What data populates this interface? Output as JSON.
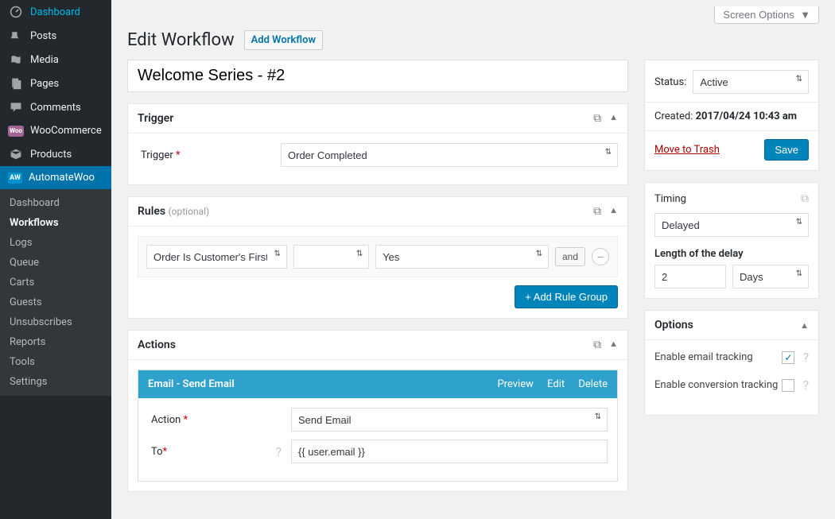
{
  "topbar": {
    "screen_options": "Screen Options"
  },
  "page": {
    "title": "Edit Workflow",
    "add_new": "Add Workflow",
    "workflow_title": "Welcome Series - #2"
  },
  "sidebar": {
    "items": [
      {
        "label": "Dashboard",
        "icon": "dashboard"
      },
      {
        "label": "Posts",
        "icon": "pin"
      },
      {
        "label": "Media",
        "icon": "media"
      },
      {
        "label": "Pages",
        "icon": "page"
      },
      {
        "label": "Comments",
        "icon": "comment"
      },
      {
        "label": "WooCommerce",
        "icon": "woo"
      },
      {
        "label": "Products",
        "icon": "products"
      },
      {
        "label": "AutomateWoo",
        "icon": "aw",
        "active": true
      }
    ],
    "submenu": [
      "Dashboard",
      "Workflows",
      "Logs",
      "Queue",
      "Carts",
      "Guests",
      "Unsubscribes",
      "Reports",
      "Tools",
      "Settings"
    ],
    "submenu_current": "Workflows"
  },
  "trigger": {
    "heading": "Trigger",
    "label": "Trigger",
    "value": "Order Completed"
  },
  "rules": {
    "heading": "Rules",
    "optional": "(optional)",
    "rule_name": "Order Is Customer's First",
    "rule_op": "",
    "rule_value": "Yes",
    "and": "and",
    "add_group": "+ Add Rule Group"
  },
  "actions": {
    "heading": "Actions",
    "block_name": "Email - Send Email",
    "preview": "Preview",
    "edit": "Edit",
    "delete": "Delete",
    "action_label": "Action",
    "action_value": "Send Email",
    "to_label": "To",
    "to_value": "{{ user.email }}"
  },
  "status": {
    "label": "Status:",
    "value": "Active",
    "created_label": "Created:",
    "created_value": "2017/04/24 10:43 am",
    "trash": "Move to Trash",
    "save": "Save"
  },
  "timing": {
    "heading": "Timing",
    "value": "Delayed",
    "delay_label": "Length of the delay",
    "delay_value": "2",
    "delay_unit": "Days"
  },
  "options": {
    "heading": "Options",
    "email_tracking": "Enable email tracking",
    "email_tracking_checked": true,
    "conversion_tracking": "Enable conversion tracking",
    "conversion_tracking_checked": false
  }
}
